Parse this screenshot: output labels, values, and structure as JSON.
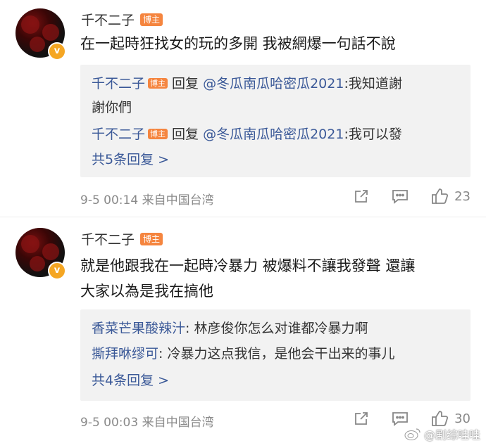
{
  "comments": [
    {
      "username": "千不二子",
      "tag": "博主",
      "text": "在一起時狂找女的玩的多開 我被網爆一句話不說",
      "replies": [
        {
          "name": "千不二子",
          "tag": "博主",
          "action": "回复",
          "mention": "@冬瓜南瓜哈密瓜2021",
          "text_line1": ":我知道謝",
          "text_line2": "謝你們"
        },
        {
          "name": "千不二子",
          "tag": "博主",
          "action": "回复",
          "mention": "@冬瓜南瓜哈密瓜2021",
          "text": ":我可以發"
        }
      ],
      "more": "共5条回复 >",
      "time": "9-5 00:14",
      "source": "来自中国台湾",
      "likes": "23"
    },
    {
      "username": "千不二子",
      "tag": "博主",
      "text_line1": "就是他跟我在一起時冷暴力 被爆料不讓我發聲 還讓",
      "text_line2": "大家以為是我在搞他",
      "replies": [
        {
          "name": "香菜芒果酸辣汁",
          "text": ": 林彦俊你怎么对谁都冷暴力啊"
        },
        {
          "name": "撕拜咻缪可",
          "text": ": 冷暴力这点我信，是他会干出来的事儿"
        }
      ],
      "more": "共4条回复 >",
      "time": "9-5 00:03",
      "source": "来自中国台湾",
      "likes": "30"
    }
  ],
  "watermark": "@剧综哇哇",
  "colors": {
    "link": "#3b5998",
    "tag": "#f5853f",
    "badge": "#f5a623",
    "reply_bg": "#f2f2f2"
  },
  "icons": [
    "share-icon",
    "comment-icon",
    "like-icon",
    "weibo-logo"
  ]
}
